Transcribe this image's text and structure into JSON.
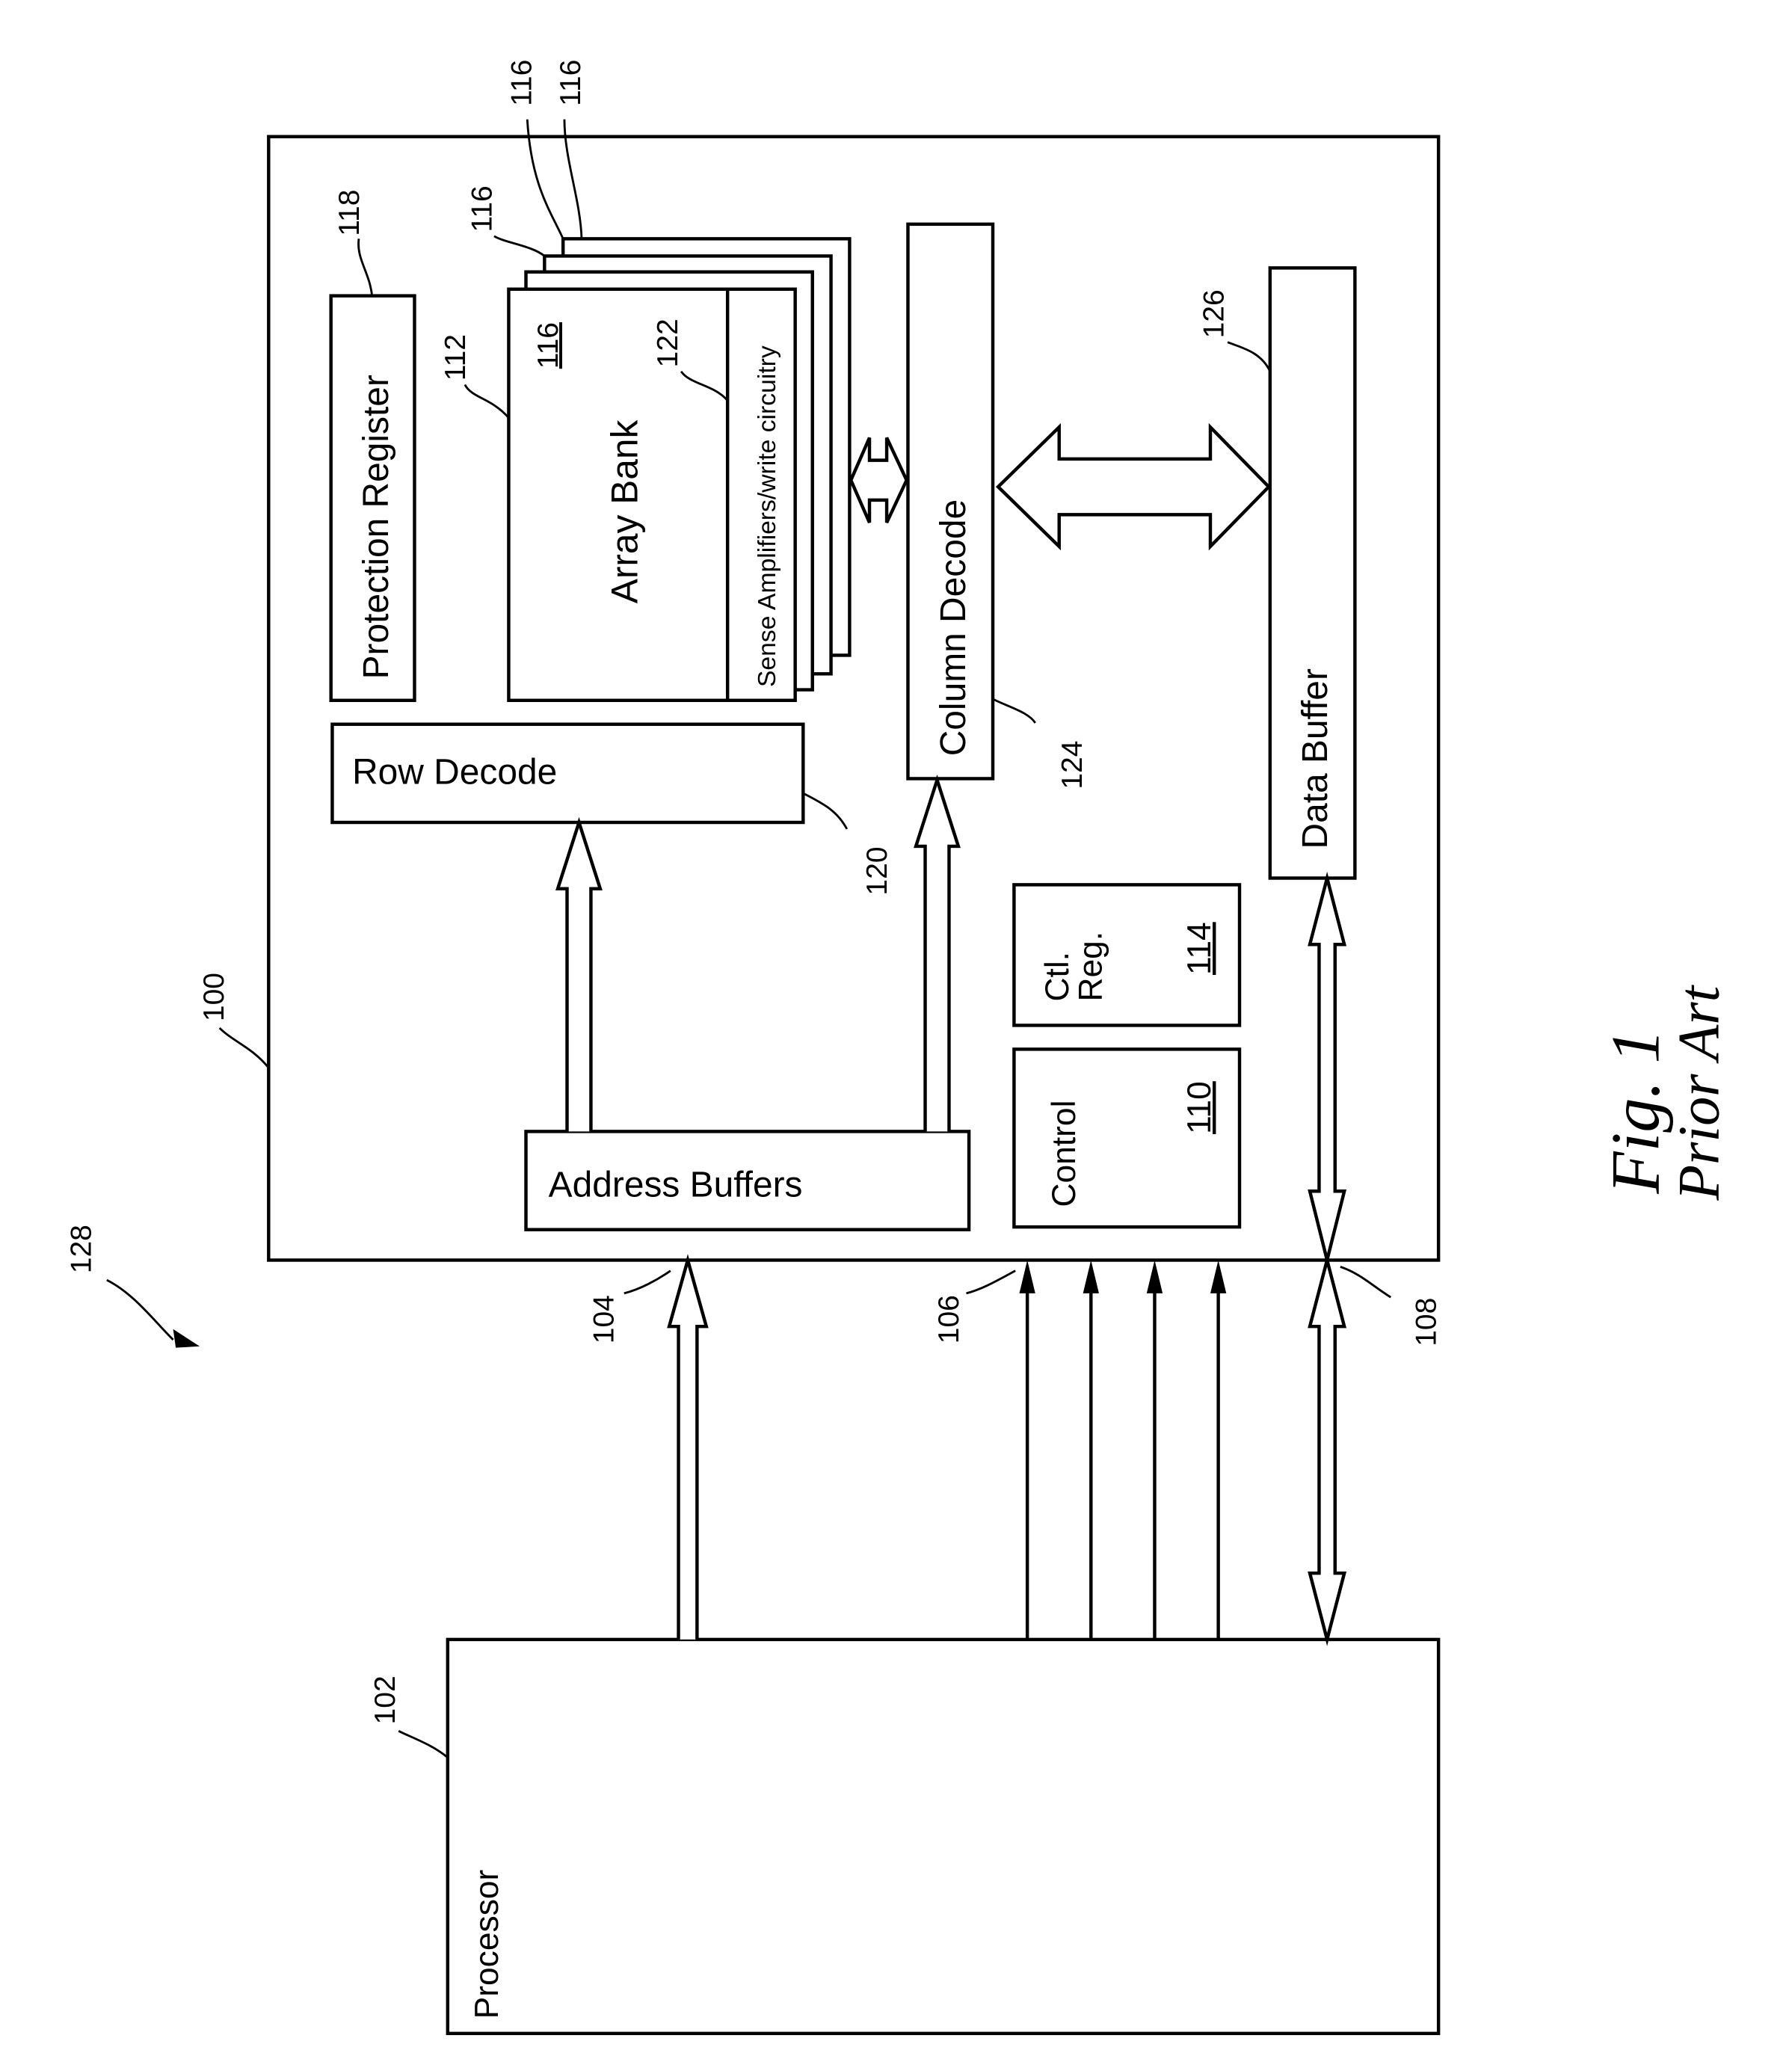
{
  "figure": {
    "title": "Fig. 1",
    "subtitle": "Prior Art"
  },
  "blocks": {
    "memory_device": {
      "ref": "100"
    },
    "processor": {
      "label": "Processor",
      "ref": "102"
    },
    "protection_register": {
      "label": "Protection Register",
      "ref": "118"
    },
    "array_bank": {
      "label": "Array Bank",
      "ref": "112",
      "bank_ref": "116"
    },
    "stacked_banks": {
      "refs": [
        "116",
        "116",
        "116"
      ]
    },
    "sense_amplifiers": {
      "label": "Sense Amplifiers/write circuitry",
      "ref": "122"
    },
    "row_decode": {
      "label": "Row Decode",
      "ref": "120"
    },
    "column_decode": {
      "label": "Column Decode",
      "ref": "124"
    },
    "data_buffer": {
      "label": "Data Buffer",
      "ref": "126"
    },
    "address_buffers": {
      "label": "Address Buffers"
    },
    "control": {
      "label": "Control",
      "ref": "110"
    },
    "ctl_reg": {
      "label_line1": "Ctl.",
      "label_line2": "Reg.",
      "ref": "114"
    }
  },
  "buses": {
    "address_bus": {
      "ref": "104"
    },
    "control_bus": {
      "ref": "106"
    },
    "data_bus": {
      "ref": "108"
    },
    "system": {
      "ref": "128"
    }
  }
}
